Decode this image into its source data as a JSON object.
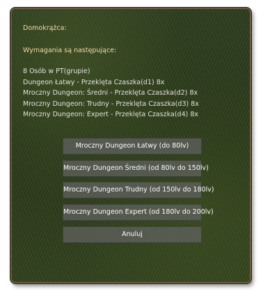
{
  "dialog": {
    "title": "Domokrążca:",
    "requirements_header": "Wymagania są następujące:",
    "requirements": [
      "8 Osób w PT(grupie)",
      "Dungeon Łatwy - Przeklęta Czaszka(d1) 8x",
      "Mroczny Dungeon: Średni - Przeklęta Czaszka(d2) 8x",
      "Mroczny Dungeon: Trudny - Przeklęta Czaszka(d3) 8x",
      "Mroczny Dungeon: Expert - Przeklęta Czaszka(d4) 8x"
    ],
    "buttons": [
      "Mroczny Dungeon Łatwy (do 80lv)",
      "Mroczny Dungeon Średni (od 80lv do 150lv)",
      "Mroczny Dungeon Trudny (od 150lv do 180lv)",
      "Mroczny Dungeon Expert (od 180lv do 200lv)",
      "Anuluj"
    ]
  },
  "colors": {
    "highlight_text": "#f2d9a6",
    "body_text": "#e2e2dc",
    "button_text": "#ffffff",
    "frame_border": "#6b5a44",
    "background": "#2d3d1c"
  }
}
